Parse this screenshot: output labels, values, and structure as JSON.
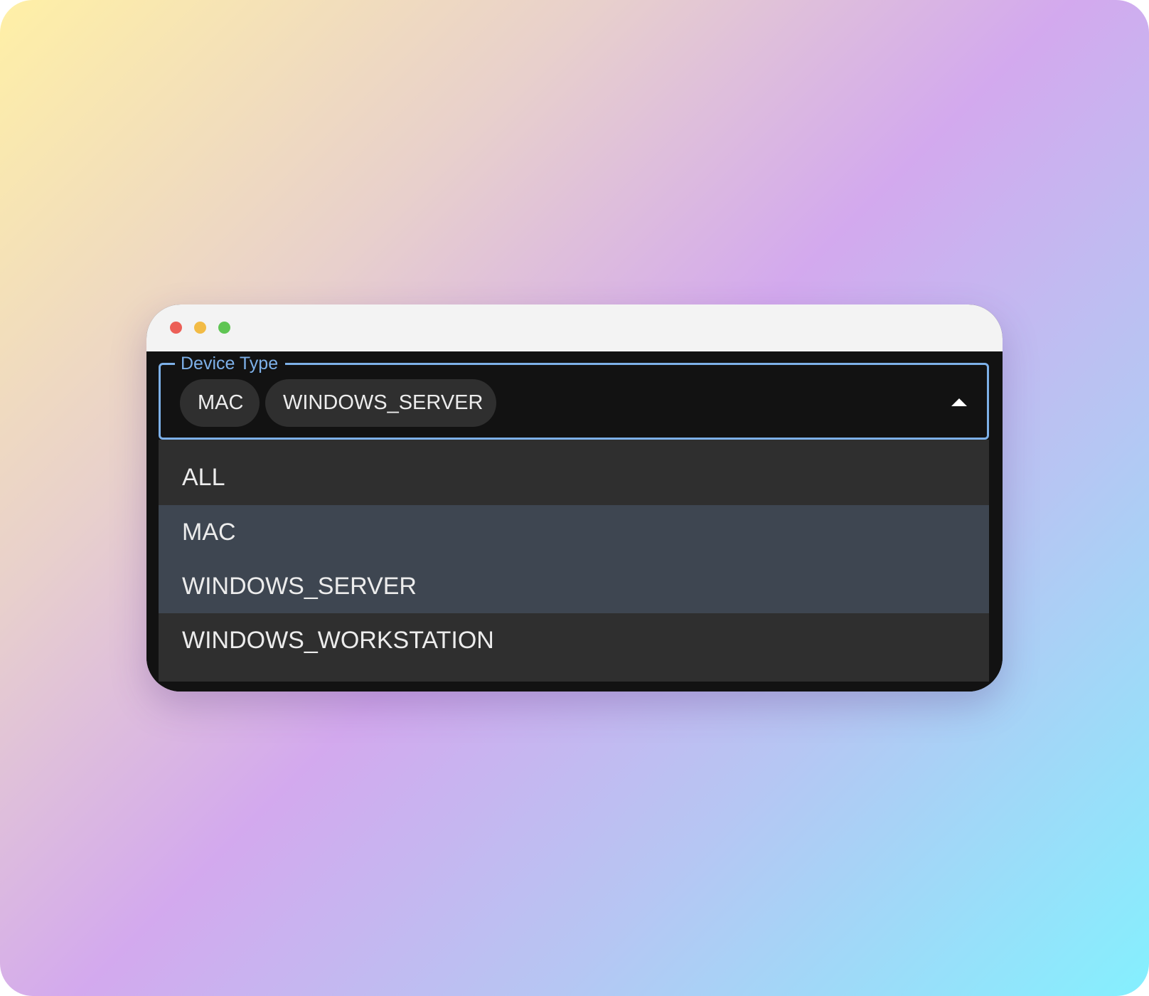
{
  "window": {
    "controls": [
      "close",
      "minimize",
      "zoom"
    ]
  },
  "field": {
    "label": "Device Type",
    "selected_chips": [
      "MAC",
      "WINDOWS_SERVER"
    ],
    "toggle_icon": "caret-up-icon",
    "accent_color": "#7db0e8"
  },
  "dropdown": {
    "options": [
      {
        "label": "ALL",
        "selected": false
      },
      {
        "label": "MAC",
        "selected": true
      },
      {
        "label": "WINDOWS_SERVER",
        "selected": true
      },
      {
        "label": "WINDOWS_WORKSTATION",
        "selected": false
      }
    ],
    "selected_bg": "#3e4651",
    "menu_bg": "#2f2f2f"
  }
}
